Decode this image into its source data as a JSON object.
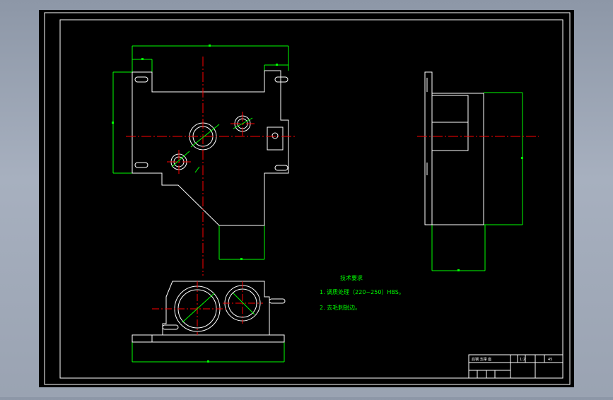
{
  "drawing": {
    "background_color": "#000000",
    "colors": {
      "outline": "#ffffff",
      "dimension": "#00ff00",
      "centerline": "#ff0000",
      "note": "#00ff00"
    }
  },
  "technical_requirements": {
    "title": "技术要求",
    "items": [
      "1. 调质处理（220~250）HBS。",
      "2. 去毛刺锐边。"
    ]
  },
  "title_block": {
    "name": "后钢 支撑 座",
    "scale": "1:2",
    "material": "45"
  }
}
